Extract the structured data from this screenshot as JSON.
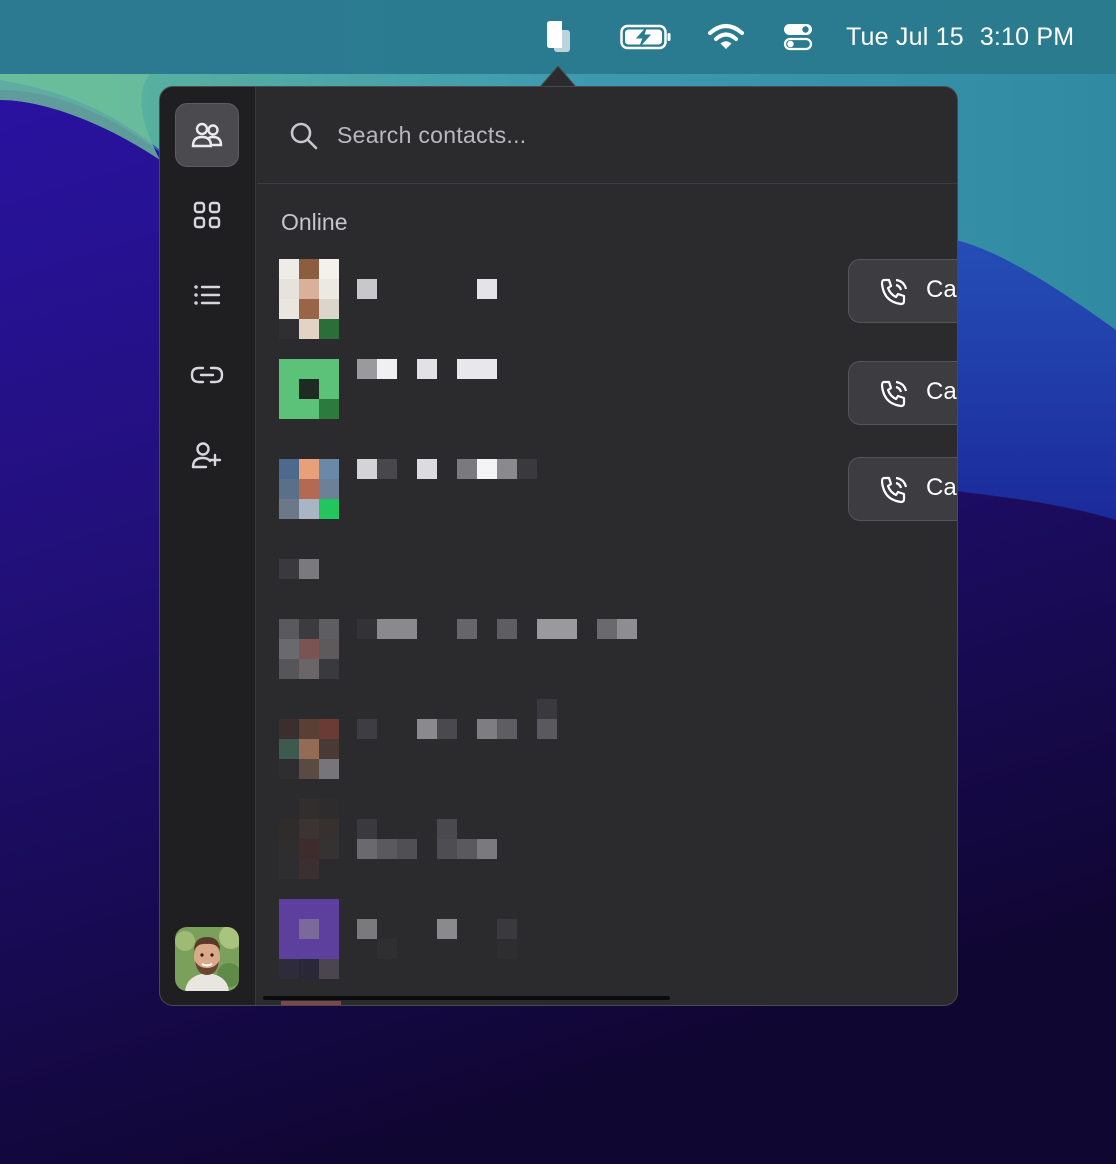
{
  "menubar": {
    "clock_day": "Tue Jul 15",
    "clock_time": "3:10 PM",
    "icons": [
      "app-icon",
      "battery-charging-icon",
      "wifi-icon",
      "control-center-icon"
    ]
  },
  "sidebar": {
    "items": [
      {
        "name": "contacts",
        "icon": "people-icon",
        "active": true
      },
      {
        "name": "apps",
        "icon": "grid-icon",
        "active": false
      },
      {
        "name": "list",
        "icon": "list-icon",
        "active": false
      },
      {
        "name": "links",
        "icon": "link-icon",
        "active": false
      },
      {
        "name": "add-user",
        "icon": "add-user-icon",
        "active": false
      }
    ]
  },
  "search": {
    "placeholder": "Search contacts..."
  },
  "contacts": {
    "section_label": "Online",
    "call_label": "Call"
  },
  "colors": {
    "popover_bg": "#2b2b2e",
    "rail_bg": "#1f1f21",
    "button_bg": "#3c3c41",
    "menubar": "#2a7b90"
  }
}
